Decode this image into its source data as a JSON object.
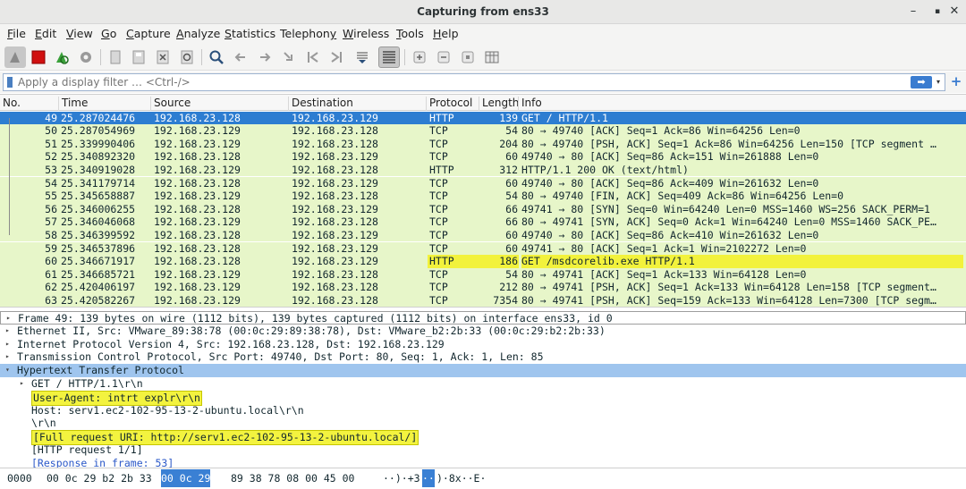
{
  "window": {
    "title": "Capturing from ens33",
    "minimize": "–",
    "maximize": "▪",
    "close": "✕"
  },
  "menu": [
    {
      "label": "File",
      "ul": "F",
      "rest": "ile"
    },
    {
      "label": "Edit",
      "ul": "E",
      "rest": "dit"
    },
    {
      "label": "View",
      "ul": "V",
      "rest": "iew"
    },
    {
      "label": "Go",
      "ul": "G",
      "rest": "o"
    },
    {
      "label": "Capture",
      "ul": "C",
      "rest": "apture"
    },
    {
      "label": "Analyze",
      "ul": "A",
      "rest": "nalyze"
    },
    {
      "label": "Statistics",
      "ul": "S",
      "rest": "tatistics"
    },
    {
      "label": "Telephony",
      "ul": "y",
      "rest": "Telephon"
    },
    {
      "label": "Wireless",
      "ul": "W",
      "rest": "ireless"
    },
    {
      "label": "Tools",
      "ul": "T",
      "rest": "ools"
    },
    {
      "label": "Help",
      "ul": "H",
      "rest": "elp"
    }
  ],
  "filter": {
    "placeholder": "Apply a display filter … <Ctrl-/>",
    "apply_icon": "➡",
    "drop_icon": "▾",
    "plus_icon": "+"
  },
  "columns": [
    "No.",
    "Time",
    "Source",
    "Destination",
    "Protocol",
    "Length",
    "Info"
  ],
  "packets": [
    {
      "no": "49",
      "time": "25.287024476",
      "src": "192.168.23.128",
      "dst": "192.168.23.129",
      "proto": "HTTP",
      "len": "139",
      "info": "GET / HTTP/1.1",
      "kind": "sel"
    },
    {
      "no": "50",
      "time": "25.287054969",
      "src": "192.168.23.129",
      "dst": "192.168.23.128",
      "proto": "TCP",
      "len": "54",
      "info": "80 → 49740 [ACK] Seq=1 Ack=86 Win=64256 Len=0",
      "kind": "tcp"
    },
    {
      "no": "51",
      "time": "25.339990406",
      "src": "192.168.23.129",
      "dst": "192.168.23.128",
      "proto": "TCP",
      "len": "204",
      "info": "80 → 49740 [PSH, ACK] Seq=1 Ack=86 Win=64256 Len=150 [TCP segment …",
      "kind": "tcp"
    },
    {
      "no": "52",
      "time": "25.340892320",
      "src": "192.168.23.128",
      "dst": "192.168.23.129",
      "proto": "TCP",
      "len": "60",
      "info": "49740 → 80 [ACK] Seq=86 Ack=151 Win=261888 Len=0",
      "kind": "tcp"
    },
    {
      "no": "53",
      "time": "25.340919028",
      "src": "192.168.23.129",
      "dst": "192.168.23.128",
      "proto": "HTTP",
      "len": "312",
      "info": "HTTP/1.1 200 OK  (text/html)",
      "kind": "http"
    },
    {
      "no": "54",
      "time": "25.341179714",
      "src": "192.168.23.128",
      "dst": "192.168.23.129",
      "proto": "TCP",
      "len": "60",
      "info": "49740 → 80 [ACK] Seq=86 Ack=409 Win=261632 Len=0",
      "kind": "tcp"
    },
    {
      "no": "55",
      "time": "25.345658887",
      "src": "192.168.23.129",
      "dst": "192.168.23.128",
      "proto": "TCP",
      "len": "54",
      "info": "80 → 49740 [FIN, ACK] Seq=409 Ack=86 Win=64256 Len=0",
      "kind": "tcp"
    },
    {
      "no": "56",
      "time": "25.346006255",
      "src": "192.168.23.128",
      "dst": "192.168.23.129",
      "proto": "TCP",
      "len": "66",
      "info": "49741 → 80 [SYN] Seq=0 Win=64240 Len=0 MSS=1460 WS=256 SACK_PERM=1",
      "kind": "tcp"
    },
    {
      "no": "57",
      "time": "25.346046068",
      "src": "192.168.23.129",
      "dst": "192.168.23.128",
      "proto": "TCP",
      "len": "66",
      "info": "80 → 49741 [SYN, ACK] Seq=0 Ack=1 Win=64240 Len=0 MSS=1460 SACK_PE…",
      "kind": "tcp"
    },
    {
      "no": "58",
      "time": "25.346399592",
      "src": "192.168.23.128",
      "dst": "192.168.23.129",
      "proto": "TCP",
      "len": "60",
      "info": "49740 → 80 [ACK] Seq=86 Ack=410 Win=261632 Len=0",
      "kind": "tcp"
    },
    {
      "no": "59",
      "time": "25.346537896",
      "src": "192.168.23.128",
      "dst": "192.168.23.129",
      "proto": "TCP",
      "len": "60",
      "info": "49741 → 80 [ACK] Seq=1 Ack=1 Win=2102272 Len=0",
      "kind": "tcp"
    },
    {
      "no": "60",
      "time": "25.346671917",
      "src": "192.168.23.128",
      "dst": "192.168.23.129",
      "proto": "HTTP",
      "len": "186",
      "info": "GET /msdcorelib.exe HTTP/1.1",
      "kind": "httphl"
    },
    {
      "no": "61",
      "time": "25.346685721",
      "src": "192.168.23.129",
      "dst": "192.168.23.128",
      "proto": "TCP",
      "len": "54",
      "info": "80 → 49741 [ACK] Seq=1 Ack=133 Win=64128 Len=0",
      "kind": "tcp"
    },
    {
      "no": "62",
      "time": "25.420406197",
      "src": "192.168.23.129",
      "dst": "192.168.23.128",
      "proto": "TCP",
      "len": "212",
      "info": "80 → 49741 [PSH, ACK] Seq=1 Ack=133 Win=64128 Len=158 [TCP segment…",
      "kind": "tcp"
    },
    {
      "no": "63",
      "time": "25.420582267",
      "src": "192.168.23.129",
      "dst": "192.168.23.128",
      "proto": "TCP",
      "len": "7354",
      "info": "80 → 49741 [PSH, ACK] Seq=159 Ack=133 Win=64128 Len=7300 [TCP segm…",
      "kind": "tcp"
    }
  ],
  "details": [
    {
      "text": "Frame 49: 139 bytes on wire (1112 bits), 139 bytes captured (1112 bits) on interface ens33, id 0",
      "arrow": "▸",
      "indent": 0,
      "style": "frame"
    },
    {
      "text": "Ethernet II, Src: VMware_89:38:78 (00:0c:29:89:38:78), Dst: VMware_b2:2b:33 (00:0c:29:b2:2b:33)",
      "arrow": "▸",
      "indent": 0,
      "style": ""
    },
    {
      "text": "Internet Protocol Version 4, Src: 192.168.23.128, Dst: 192.168.23.129",
      "arrow": "▸",
      "indent": 0,
      "style": ""
    },
    {
      "text": "Transmission Control Protocol, Src Port: 49740, Dst Port: 80, Seq: 1, Ack: 1, Len: 85",
      "arrow": "▸",
      "indent": 0,
      "style": ""
    },
    {
      "text": "Hypertext Transfer Protocol",
      "arrow": "▾",
      "indent": 0,
      "style": "selhdr"
    },
    {
      "text": "GET / HTTP/1.1\\r\\n",
      "arrow": "▸",
      "indent": 1,
      "style": ""
    },
    {
      "text": "User-Agent: intrt explr\\r\\n",
      "arrow": "",
      "indent": 1,
      "style": "yl"
    },
    {
      "text": "Host: serv1.ec2-102-95-13-2-ubuntu.local\\r\\n",
      "arrow": "",
      "indent": 1,
      "style": ""
    },
    {
      "text": "\\r\\n",
      "arrow": "",
      "indent": 1,
      "style": ""
    },
    {
      "text": "[Full request URI: http://serv1.ec2-102-95-13-2-ubuntu.local/]",
      "arrow": "",
      "indent": 1,
      "style": "yl"
    },
    {
      "text": "[HTTP request 1/1]",
      "arrow": "",
      "indent": 1,
      "style": ""
    },
    {
      "text": "[Response in frame: 53]",
      "arrow": "",
      "indent": 1,
      "style": "link"
    }
  ],
  "bytes": {
    "offset": "0000",
    "hex_a": "00 0c 29 b2 2b 33",
    "hex_hl": "00 0c  29",
    "hex_b": "89 38 78 08 00 45 00",
    "ascii_a": "··)·+3",
    "ascii_hl": "··",
    "ascii_b": ")·8x··E·"
  },
  "colors": {
    "selected": "#2d7dd1",
    "tcp_row": "#e7f6c9",
    "highlight": "#f3f33f",
    "header_sel": "#9fc5ee"
  }
}
